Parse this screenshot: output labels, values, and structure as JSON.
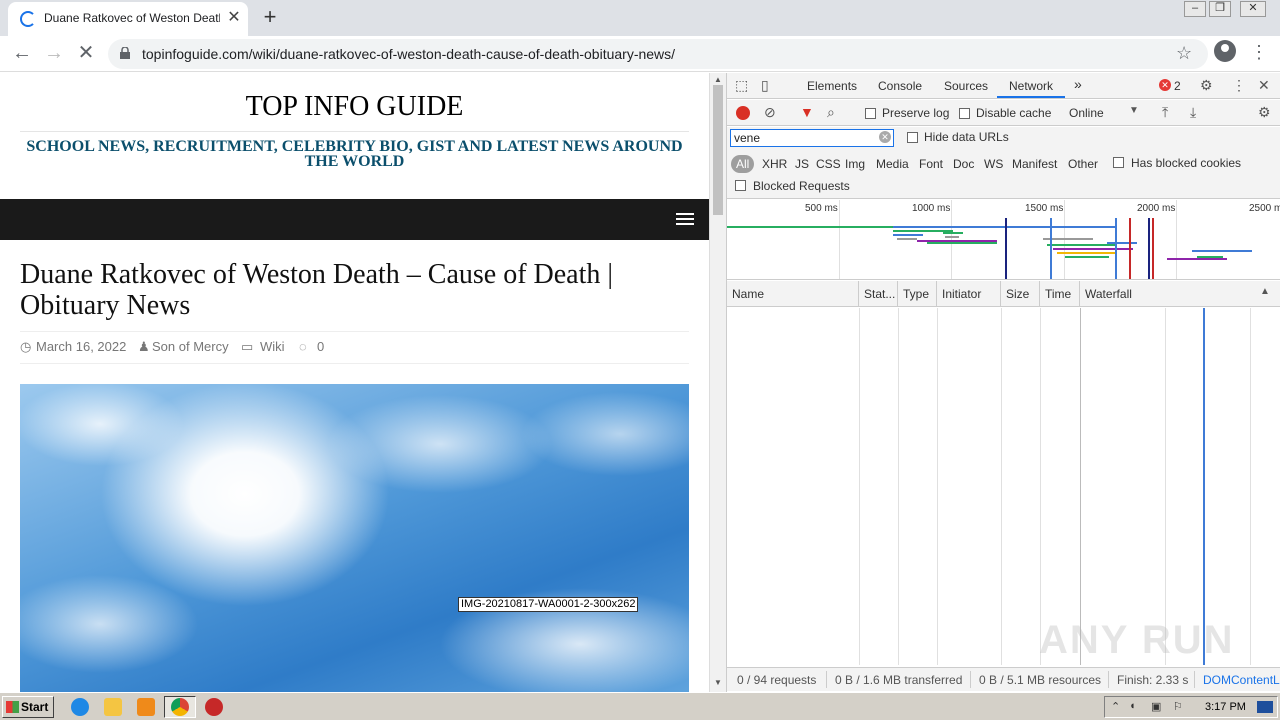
{
  "browser": {
    "tab_title": "Duane Ratkovec of Weston Death – Cause of Death | Obituary News",
    "tab_close": "✕",
    "new_tab": "+",
    "url": "topinfoguide.com/wiki/duane-ratkovec-of-weston-death-cause-of-death-obituary-news/"
  },
  "page": {
    "site_title": "TOP INFO GUIDE",
    "tagline": "SCHOOL NEWS, RECRUITMENT, CELEBRITY BIO, GIST AND LATEST NEWS AROUND THE WORLD",
    "post_title": "Duane Ratkovec of Weston Death – Cause of Death | Obituary News",
    "meta": {
      "date": "March 16, 2022",
      "author": "Son of Mercy",
      "category": "Wiki",
      "comments": "0"
    },
    "image_tooltip": "IMG-20210817-WA0001-2-300x262"
  },
  "devtools": {
    "tabs": [
      "Elements",
      "Console",
      "Sources",
      "Network"
    ],
    "active_tab": "Network",
    "more_tabs": "»",
    "error_count": "2",
    "toolbar": {
      "preserve_log": "Preserve log",
      "disable_cache": "Disable cache",
      "throttle": "Online"
    },
    "filter": {
      "value": "vene",
      "hide_data_urls": "Hide data URLs",
      "types": [
        "All",
        "XHR",
        "JS",
        "CSS",
        "Img",
        "Media",
        "Font",
        "Doc",
        "WS",
        "Manifest",
        "Other"
      ],
      "has_blocked_cookies": "Has blocked cookies",
      "blocked_requests": "Blocked Requests"
    },
    "overview_ticks": [
      "500 ms",
      "1000 ms",
      "1500 ms",
      "2000 ms",
      "2500 m"
    ],
    "columns": [
      "Name",
      "Stat...",
      "Type",
      "Initiator",
      "Size",
      "Time",
      "Waterfall"
    ],
    "status": {
      "requests": "0 / 94 requests",
      "transferred": "0 B / 1.6 MB transferred",
      "resources": "0 B / 5.1 MB resources",
      "finish": "Finish: 2.33 s",
      "domcontent": "DOMContentL"
    },
    "watermark": "ANY RUN"
  },
  "taskbar": {
    "start": "Start",
    "clock": "3:17 PM"
  },
  "colors": {
    "devtools_accent": "#1a73e8",
    "record_red": "#d93025",
    "navbar_bg": "#1a1a1a",
    "tagline": "#0b4f6c"
  }
}
